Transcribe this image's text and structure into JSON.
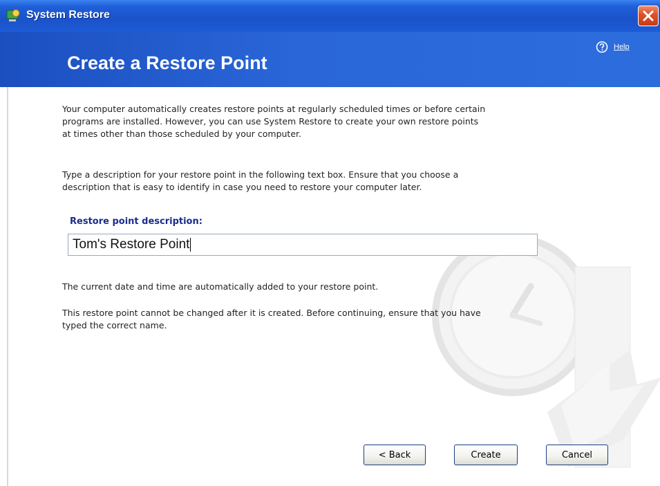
{
  "window": {
    "title": "System Restore",
    "close_icon": "close-icon",
    "app_icon": "system-restore-icon"
  },
  "header": {
    "title": "Create a Restore Point",
    "help_label": "Help",
    "help_icon": "help-icon"
  },
  "body": {
    "intro_lines": [
      "Your computer automatically creates restore points at regularly scheduled times or before certain",
      "programs are installed. However, you can use System Restore to create your own restore points",
      "at times other than those scheduled by your computer."
    ],
    "instruction_lines": [
      "Type a description for your restore point in the following text box. Ensure that you choose a",
      "description that is easy to identify in case you need to restore your computer later."
    ],
    "field_label": "Restore point description:",
    "field_value": "Tom's Restore Point",
    "note": "The current date and time are automatically added to your restore point.",
    "warning_lines": [
      "This restore point cannot be changed after it is created. Before continuing, ensure that you have",
      "typed the correct name."
    ]
  },
  "buttons": {
    "back": "< Back",
    "create": "Create",
    "cancel": "Cancel"
  },
  "colors": {
    "title_bar": "#1f5fd8",
    "header": "#2a66d8",
    "label": "#1a2c8c",
    "close": "#e0532a"
  }
}
